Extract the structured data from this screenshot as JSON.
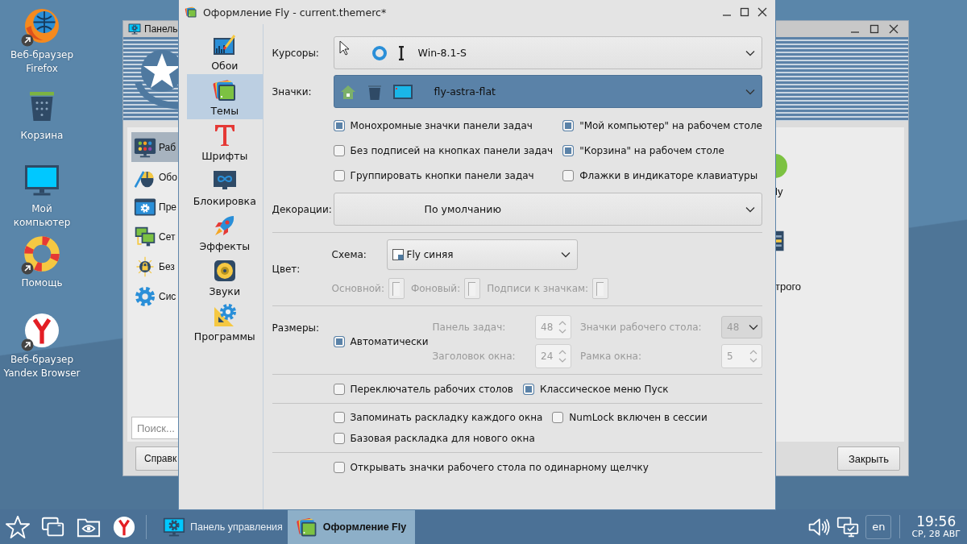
{
  "desktop_icons": [
    {
      "label": "Веб-браузер Firefox",
      "kind": "firefox",
      "shortcut": true
    },
    {
      "label": "Корзина",
      "kind": "trash",
      "shortcut": false
    },
    {
      "label": "Мой компьютер",
      "kind": "computer",
      "shortcut": false
    },
    {
      "label": "Помощь",
      "kind": "help",
      "shortcut": true
    },
    {
      "label": "Веб-браузер Yandex Browser",
      "kind": "yandex",
      "shortcut": true
    }
  ],
  "control_panel": {
    "title": "Панель",
    "items": [
      {
        "label": "Раб",
        "kind": "desktop",
        "selected": true
      },
      {
        "label": "Обо",
        "kind": "mouse",
        "selected": false
      },
      {
        "label": "Пре",
        "kind": "window",
        "selected": false
      },
      {
        "label": "Сет",
        "kind": "network",
        "selected": false
      },
      {
        "label": "Без",
        "kind": "security",
        "selected": false
      },
      {
        "label": "Сис",
        "kind": "gear",
        "selected": false
      }
    ],
    "search": {
      "placeholder": "Поиск..."
    },
    "help_button": "Справк",
    "right_items": [
      {
        "label": "ly",
        "kind": "circle"
      },
      {
        "label": "трого",
        "kind": "list"
      }
    ],
    "close_button": "Закрыть"
  },
  "dialog": {
    "title": "Оформление Fly - current.themerc*",
    "nav": [
      {
        "label": "Обои",
        "kind": "wallpaper",
        "selected": false
      },
      {
        "label": "Темы",
        "kind": "themes",
        "selected": true
      },
      {
        "label": "Шрифты",
        "kind": "fonts",
        "selected": false
      },
      {
        "label": "Блокировка",
        "kind": "lock",
        "selected": false
      },
      {
        "label": "Эффекты",
        "kind": "effects",
        "selected": false
      },
      {
        "label": "Звуки",
        "kind": "sounds",
        "selected": false
      },
      {
        "label": "Программы",
        "kind": "programs",
        "selected": false
      }
    ],
    "cursors": {
      "label": "Курсоры:",
      "value": "Win-8.1-S",
      "selected": false
    },
    "icons": {
      "label": "Значки:",
      "value": "fly-astra-flat",
      "selected": true
    },
    "icon_options": [
      {
        "label": "Монохромные значки панели задач",
        "checked": true
      },
      {
        "label": "\"Мой компьютер\" на рабочем столе",
        "checked": true
      },
      {
        "label": "Без подписей на кнопках панели задач",
        "checked": false
      },
      {
        "label": "\"Корзина\" на рабочем столе",
        "checked": true
      },
      {
        "label": "Группировать кнопки панели задач",
        "checked": false
      },
      {
        "label": "Флажки в индикаторе клавиатуры",
        "checked": false
      }
    ],
    "decorations": {
      "label": "Декорации:",
      "value": "По умолчанию",
      "selected": false
    },
    "color": {
      "label": "Цвет:",
      "scheme_label": "Схема:",
      "scheme": "Fly синяя",
      "swatches": [
        {
          "label": "Основной:",
          "disabled": true
        },
        {
          "label": "Фоновый:",
          "disabled": true
        },
        {
          "label": "Подписи к значкам:",
          "disabled": true
        }
      ]
    },
    "sizes": {
      "label": "Размеры:",
      "auto": {
        "label": "Автоматически",
        "checked": true
      },
      "fields": [
        {
          "label": "Панель задач:",
          "value": "48",
          "kind": "spin",
          "disabled": true
        },
        {
          "label": "Значки рабочего стола:",
          "value": "48",
          "kind": "combo",
          "disabled": true
        },
        {
          "label": "Заголовок окна:",
          "value": "24",
          "kind": "spin",
          "disabled": true
        },
        {
          "label": "Рамка окна:",
          "value": "5",
          "kind": "spin",
          "disabled": true
        }
      ]
    },
    "option_groups": [
      {
        "options": [
          {
            "label": "Переключатель рабочих столов",
            "checked": false
          },
          {
            "label": "Классическое меню Пуск",
            "checked": true
          }
        ]
      },
      {
        "options": [
          {
            "label": "Запоминать раскладку каждого окна",
            "checked": false
          },
          {
            "label": "NumLock включен в сессии",
            "checked": false
          },
          {
            "label": "Базовая раскладка для нового окна",
            "checked": false
          }
        ]
      },
      {
        "options": [
          {
            "label": "Открывать значки рабочего стола по одинарному щелчку",
            "checked": false
          }
        ]
      }
    ]
  },
  "taskbar": {
    "launchers": [
      {
        "kind": "star"
      },
      {
        "kind": "windows"
      },
      {
        "kind": "folder"
      },
      {
        "kind": "yandex"
      }
    ],
    "tasks": [
      {
        "label": "Панель управления",
        "kind": "control-panel",
        "selected": false
      },
      {
        "label": "Оформление Fly",
        "kind": "themes",
        "selected": true
      }
    ],
    "tray": [
      {
        "kind": "volume"
      },
      {
        "kind": "network"
      }
    ],
    "language": "en",
    "time": "19:56",
    "date": "СР, 28 АВГ"
  }
}
